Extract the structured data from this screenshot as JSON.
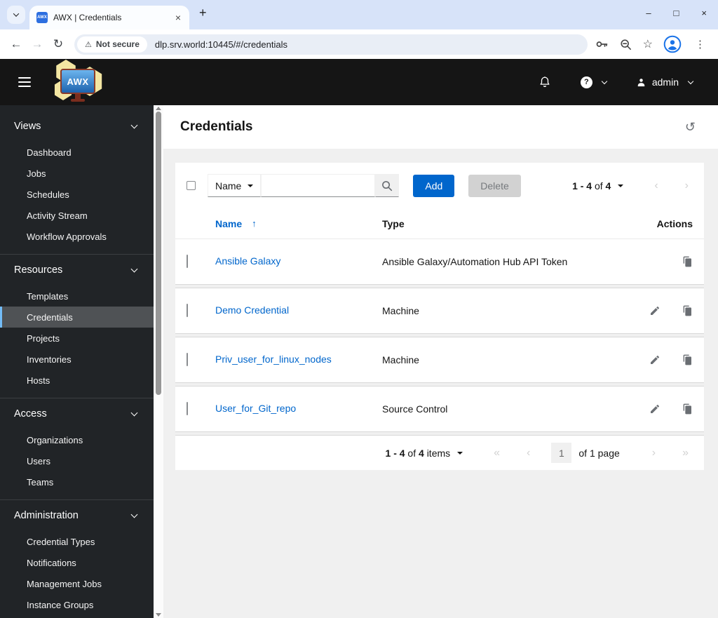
{
  "glyphs": {
    "close": "×",
    "plus": "+",
    "minimize": "–",
    "maximize": "□",
    "menu_dots": "⋮",
    "back": "←",
    "forward": "→",
    "reload": "↻",
    "warning": "⚠",
    "star": "☆",
    "question": "?",
    "history": "↺",
    "sort_asc": "↑",
    "first": "«",
    "prev": "‹",
    "next": "›",
    "last": "»"
  },
  "colors": {
    "accent_blue": "#0066cc",
    "masthead_black": "#151515",
    "sidebar_dark": "#212427",
    "active_item_border": "#73bcf7"
  },
  "browser": {
    "tab_title": "AWX | Credentials",
    "favicon_text": "AWX",
    "security_label": "Not secure",
    "url": "dlp.srv.world:10445/#/credentials"
  },
  "app_header": {
    "brand": "AWX",
    "user": "admin"
  },
  "sidebar": {
    "groups": [
      {
        "label": "Views",
        "items": [
          {
            "label": "Dashboard"
          },
          {
            "label": "Jobs"
          },
          {
            "label": "Schedules"
          },
          {
            "label": "Activity Stream"
          },
          {
            "label": "Workflow Approvals"
          }
        ]
      },
      {
        "label": "Resources",
        "items": [
          {
            "label": "Templates"
          },
          {
            "label": "Credentials"
          },
          {
            "label": "Projects"
          },
          {
            "label": "Inventories"
          },
          {
            "label": "Hosts"
          }
        ]
      },
      {
        "label": "Access",
        "items": [
          {
            "label": "Organizations"
          },
          {
            "label": "Users"
          },
          {
            "label": "Teams"
          }
        ]
      },
      {
        "label": "Administration",
        "items": [
          {
            "label": "Credential Types"
          },
          {
            "label": "Notifications"
          },
          {
            "label": "Management Jobs"
          },
          {
            "label": "Instance Groups"
          }
        ]
      }
    ]
  },
  "page": {
    "title": "Credentials"
  },
  "card": {
    "filter_field": "Name",
    "search_value": "",
    "add_label": "Add",
    "delete_label": "Delete",
    "top_pagination": {
      "range": "1 - 4",
      "of": "of",
      "total": "4"
    },
    "table": {
      "header_name": "Name",
      "header_type": "Type",
      "header_actions": "Actions",
      "rows": [
        {
          "name": "Ansible Galaxy",
          "type": "Ansible Galaxy/Automation Hub API Token"
        },
        {
          "name": "Demo Credential",
          "type": "Machine"
        },
        {
          "name": "Priv_user_for_linux_nodes",
          "type": "Machine"
        },
        {
          "name": "User_for_Git_repo",
          "type": "Source Control"
        }
      ]
    },
    "bottom_pagination": {
      "range": "1 - 4",
      "of": "of",
      "total": "4",
      "suffix": "items",
      "page": "1",
      "pages": "of 1 page"
    }
  }
}
